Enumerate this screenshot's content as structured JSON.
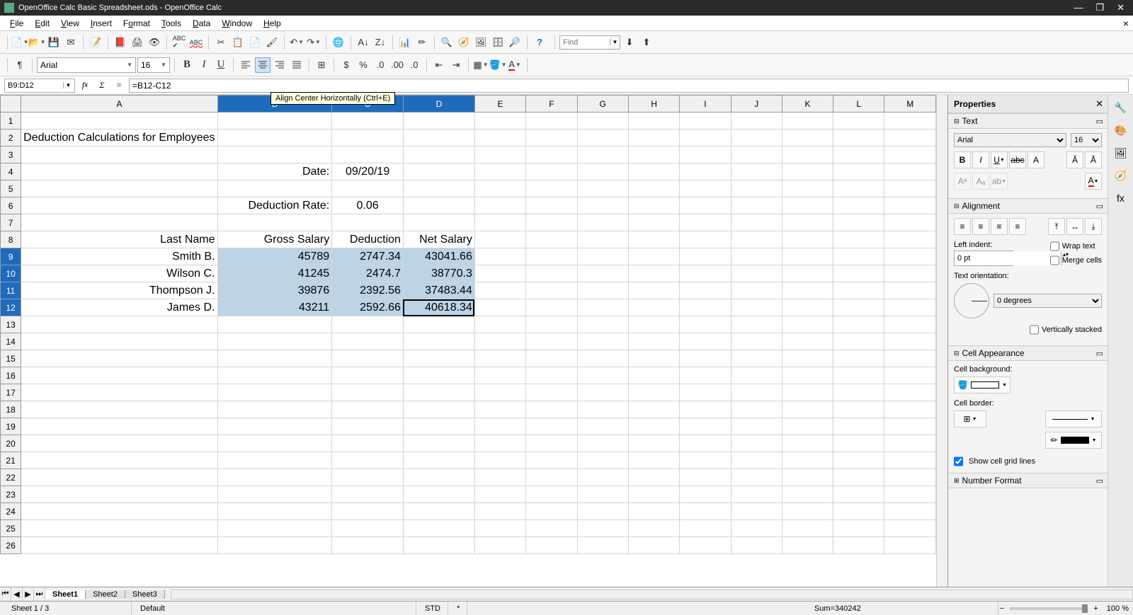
{
  "titlebar": {
    "title": "OpenOffice Calc Basic Spreadsheet.ods - OpenOffice Calc"
  },
  "menubar": {
    "items": [
      "File",
      "Edit",
      "View",
      "Insert",
      "Format",
      "Tools",
      "Data",
      "Window",
      "Help"
    ]
  },
  "find": {
    "placeholder": "Find"
  },
  "format_toolbar": {
    "font_name": "Arial",
    "font_size": "16"
  },
  "formula_bar": {
    "name_box": "B9:D12",
    "formula": "=B12-C12"
  },
  "tooltip": "Align Center Horizontally (Ctrl+E)",
  "columns": [
    "A",
    "B",
    "C",
    "D",
    "E",
    "F",
    "G",
    "H",
    "I",
    "J",
    "K",
    "L",
    "M"
  ],
  "selected_columns": [
    "B",
    "C",
    "D"
  ],
  "selected_rows": [
    9,
    10,
    11,
    12
  ],
  "cells": {
    "A2": "Deduction Calculations for Employees",
    "B4": "Date:",
    "C4": "09/20/19",
    "B6": "Deduction Rate:",
    "C6": "0.06",
    "A8": "Last Name",
    "B8": "Gross Salary",
    "C8": "Deduction",
    "D8": "Net Salary",
    "A9": "Smith B.",
    "B9": "45789",
    "C9": "2747.34",
    "D9": "43041.66",
    "A10": "Wilson C.",
    "B10": "41245",
    "C10": "2474.7",
    "D10": "38770.3",
    "A11": "Thompson J.",
    "B11": "39876",
    "C11": "2392.56",
    "D11": "37483.44",
    "A12": "James D.",
    "B12": "43211",
    "C12": "2592.66",
    "D12": "40618.34"
  },
  "sheet_tabs": {
    "tabs": [
      "Sheet1",
      "Sheet2",
      "Sheet3"
    ],
    "active": "Sheet1"
  },
  "statusbar": {
    "sheet_pos": "Sheet 1 / 3",
    "style": "Default",
    "mode": "STD",
    "modified": "*",
    "sum": "Sum=340242",
    "zoom_minus": "−",
    "zoom_plus": "+",
    "zoom": "100 %"
  },
  "properties": {
    "title": "Properties",
    "sections": {
      "text": {
        "label": "Text",
        "font_name": "Arial",
        "font_size": "16"
      },
      "alignment": {
        "label": "Alignment",
        "left_indent_label": "Left indent:",
        "left_indent_value": "0 pt",
        "wrap_text": "Wrap text",
        "merge_cells": "Merge cells",
        "orientation_label": "Text orientation:",
        "orientation_value": "0 degrees",
        "vertically_stacked": "Vertically stacked"
      },
      "cell_appearance": {
        "label": "Cell Appearance",
        "bg_label": "Cell background:",
        "border_label": "Cell border:",
        "show_grid": "Show cell grid lines"
      },
      "number_format": {
        "label": "Number Format"
      }
    }
  }
}
